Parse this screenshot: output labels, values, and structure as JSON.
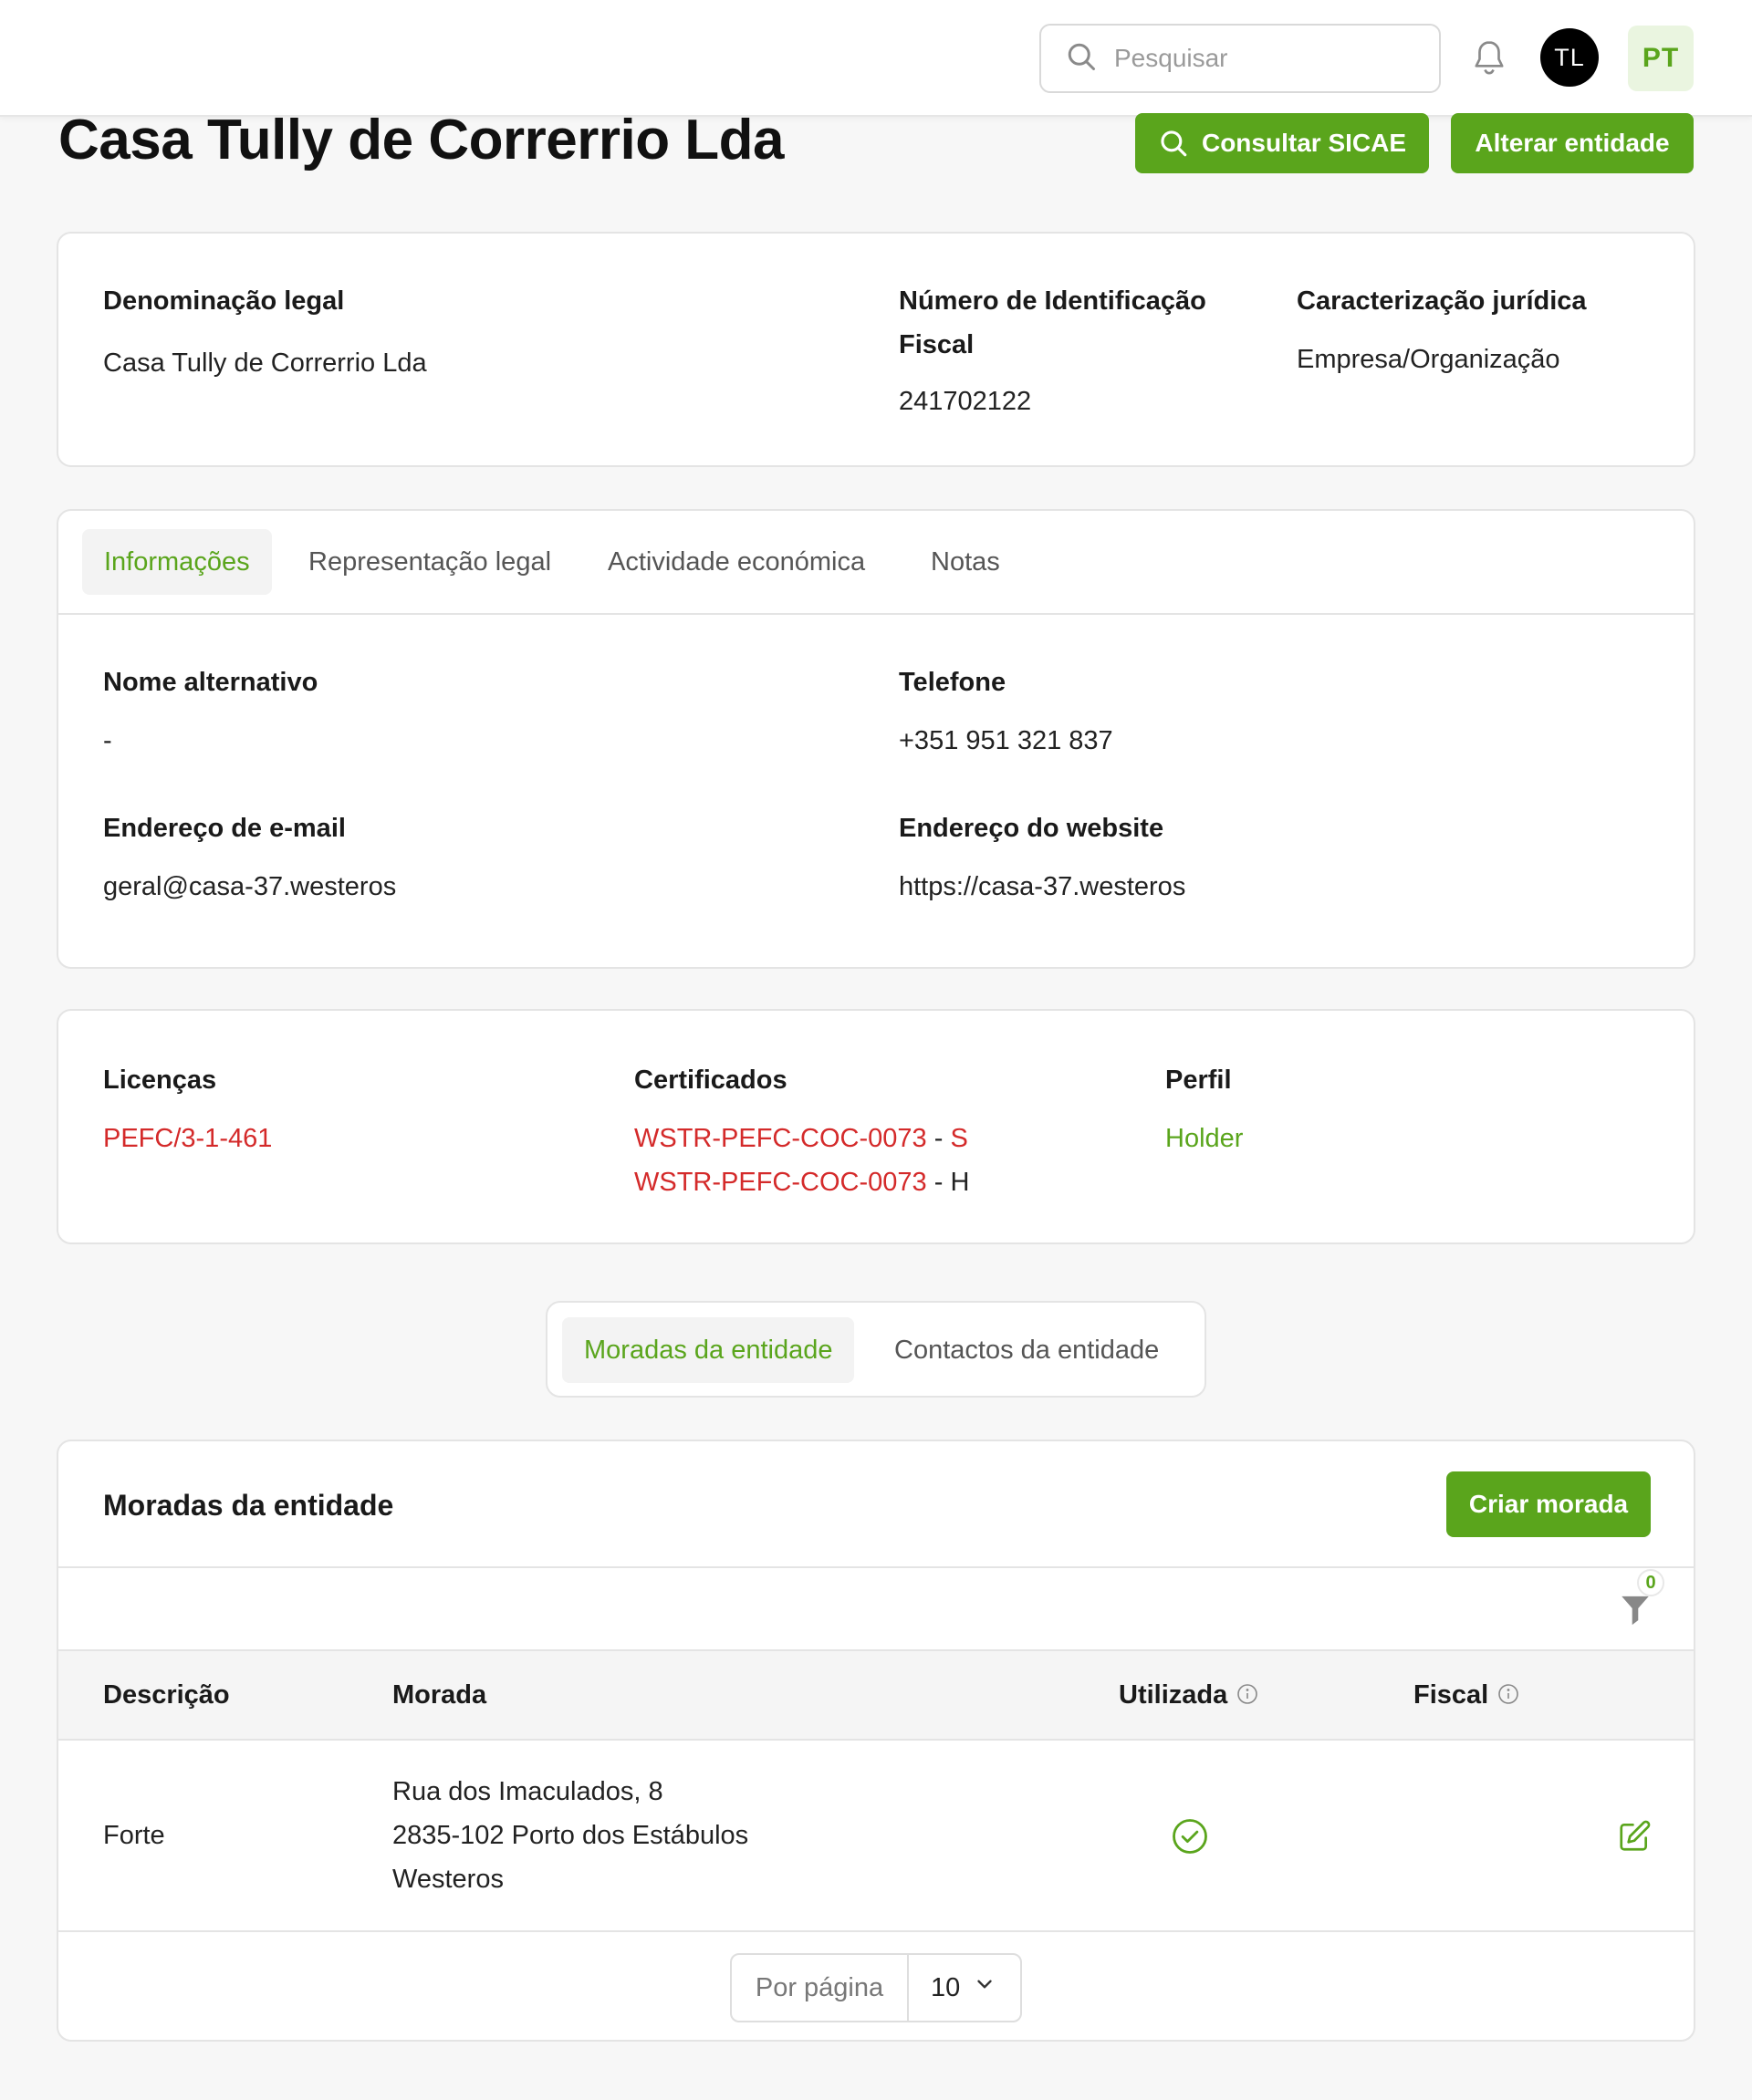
{
  "header": {
    "search_placeholder": "Pesquisar",
    "user_initials": "TL",
    "language": "PT"
  },
  "page": {
    "title": "Casa Tully de Correrrio Lda",
    "consult_button": "Consultar SICAE",
    "edit_button": "Alterar entidade"
  },
  "summary": {
    "legal_name_label": "Denominação legal",
    "legal_name_value": "Casa Tully de Correrrio Lda",
    "nif_label_line1": "Número de Identificação",
    "nif_label_line2": "Fiscal",
    "nif_value": "241702122",
    "legal_type_label": "Caracterização jurídica",
    "legal_type_value": "Empresa/Organização"
  },
  "tabs": [
    {
      "label": "Informações",
      "active": true
    },
    {
      "label": "Representação legal",
      "active": false
    },
    {
      "label": "Actividade económica",
      "active": false
    },
    {
      "label": "Notas",
      "active": false
    }
  ],
  "info": {
    "alt_name_label": "Nome alternativo",
    "alt_name_value": "-",
    "phone_label": "Telefone",
    "phone_value": "+351 951 321 837",
    "email_label": "Endereço de e-mail",
    "email_value": "geral@casa-37.westeros",
    "website_label": "Endereço do website",
    "website_value": "https://casa-37.westeros"
  },
  "licenses": {
    "licenses_label": "Licenças",
    "license_value": "PEFC/3-1-461",
    "certificates_label": "Certificados",
    "certificates": [
      {
        "code": "WSTR-PEFC-COC-0073",
        "separator": " - ",
        "suffix": "S"
      },
      {
        "code": "WSTR-PEFC-COC-0073",
        "separator": " - ",
        "suffix": "H"
      }
    ],
    "profile_label": "Perfil",
    "profile_value": "Holder"
  },
  "segment": {
    "addresses_tab": "Moradas da entidade",
    "contacts_tab": "Contactos da entidade"
  },
  "addresses": {
    "title": "Moradas da entidade",
    "create_button": "Criar morada",
    "filter_count": "0",
    "columns": {
      "description": "Descrição",
      "address": "Morada",
      "used": "Utilizada",
      "fiscal": "Fiscal"
    },
    "rows": [
      {
        "description": "Forte",
        "address_line1": "Rua dos Imaculados, 8",
        "address_line2": "2835-102 Porto dos Estábulos",
        "address_line3": "Westeros",
        "used": true,
        "fiscal": false
      }
    ],
    "per_page_label": "Por página",
    "per_page_value": "10"
  },
  "colors": {
    "accent_green": "#5aa51c",
    "link_red": "#d42a2a"
  },
  "icons": [
    "search-icon",
    "bell-icon",
    "info-icon",
    "filter-icon",
    "check-circle-icon",
    "edit-icon",
    "chevron-down-icon"
  ]
}
